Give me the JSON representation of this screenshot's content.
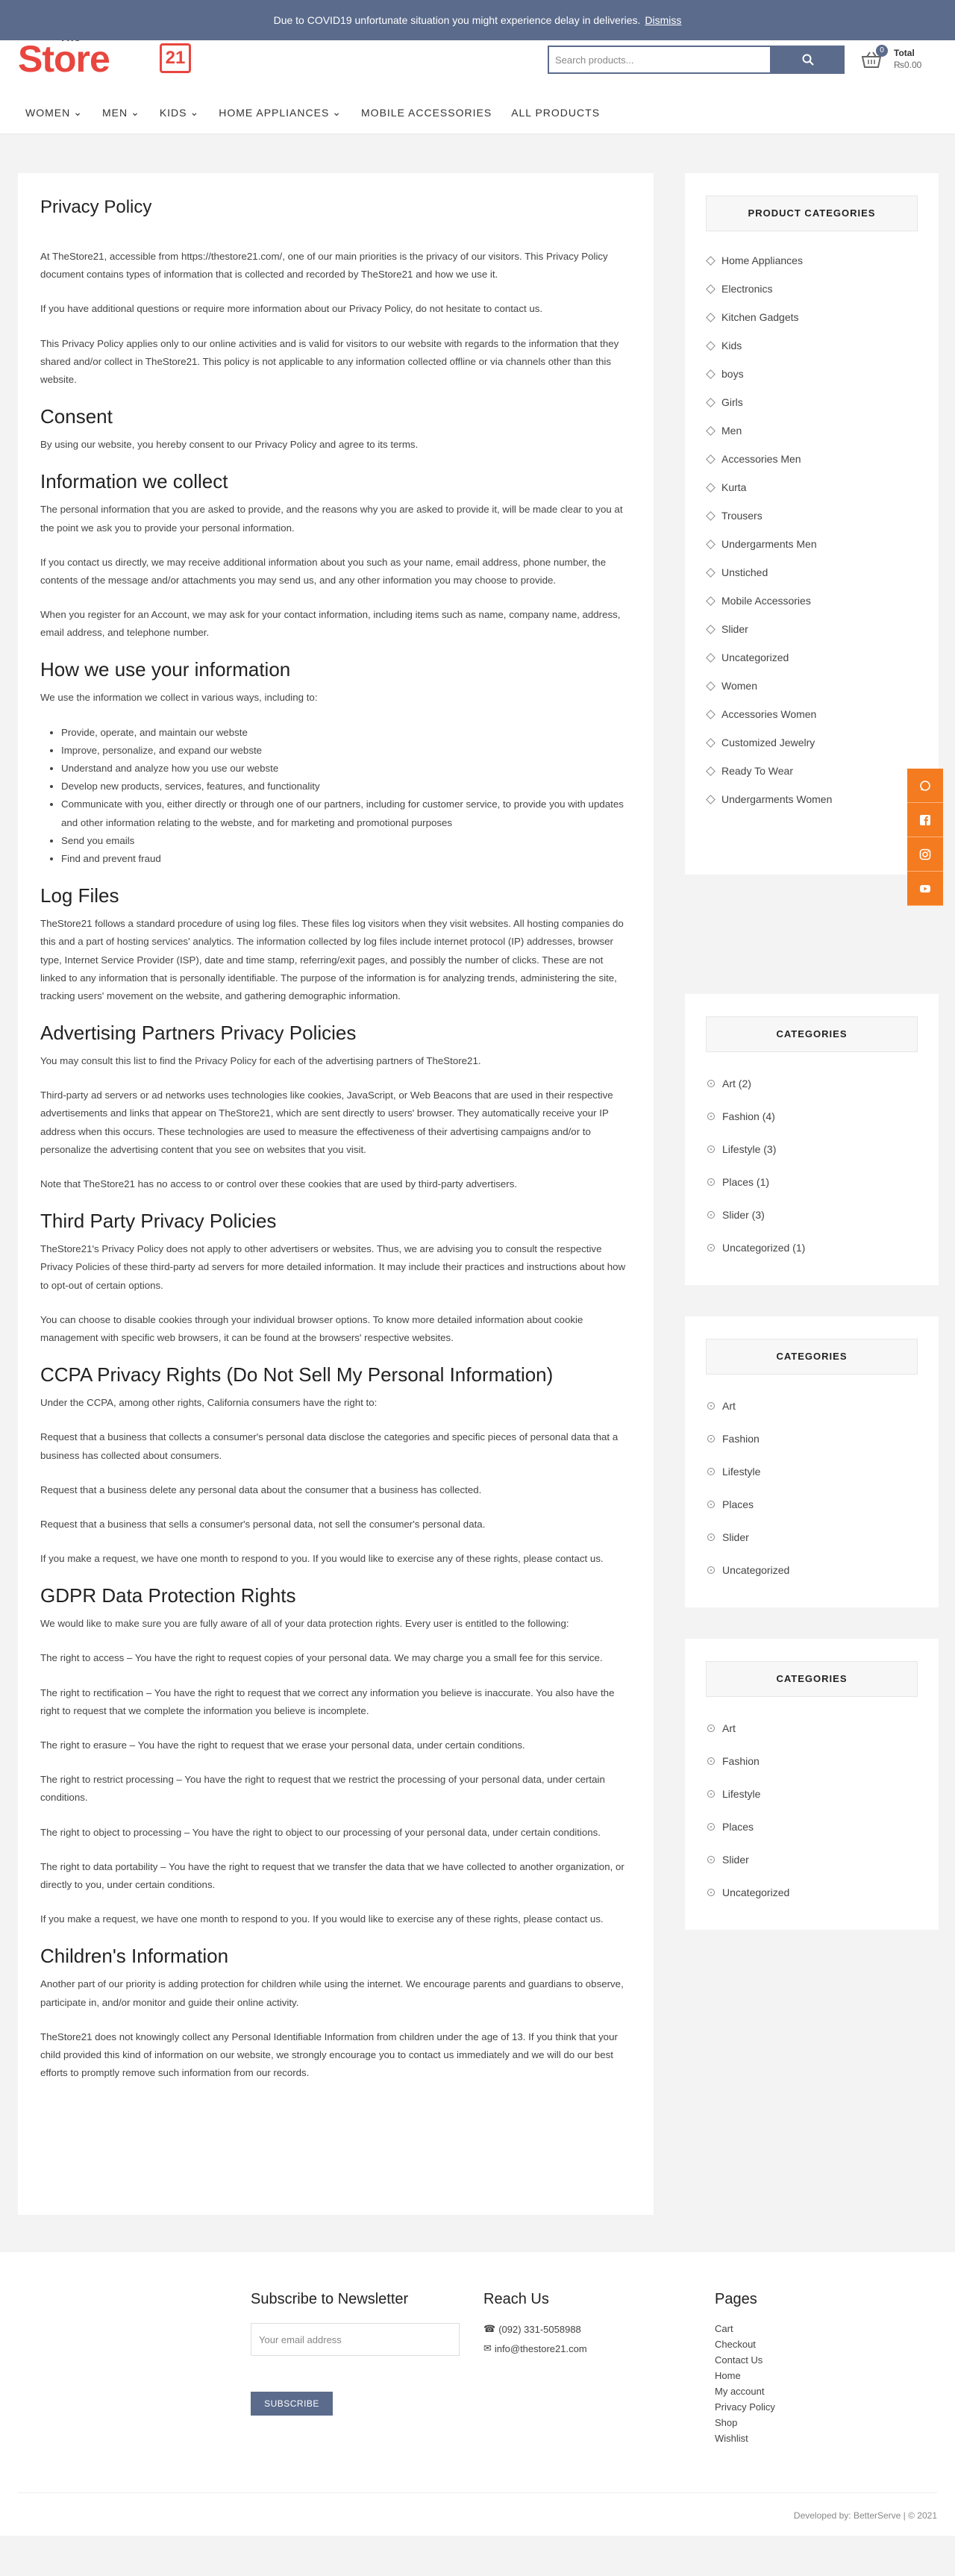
{
  "notice": {
    "text": "Due to COVID19 unfortunate situation you might experience delay in deliveries.",
    "dismiss": "Dismiss"
  },
  "header": {
    "logo": {
      "the": "The",
      "store": "Store",
      "num": "21"
    },
    "search_placeholder": "Search products...",
    "cart": {
      "count": "0",
      "label": "Total",
      "amount": "₨0.00"
    },
    "nav": [
      "WOMEN",
      "MEN",
      "KIDS",
      "HOME APPLIANCES",
      "MOBILE ACCESSORIES",
      "ALL PRODUCTS"
    ]
  },
  "page": {
    "title": "Privacy Policy",
    "intro": [
      "At TheStore21, accessible from https://thestore21.com/, one of our main priorities is the privacy of our visitors. This Privacy Policy document contains types of information that is collected and recorded by TheStore21 and how we use it.",
      "If you have additional questions or require more information about our Privacy Policy, do not hesitate to contact us.",
      "This Privacy Policy applies only to our online activities and is valid for visitors to our website with regards to the information that they shared and/or collect in TheStore21. This policy is not applicable to any information collected offline or via channels other than this website."
    ],
    "consent_h": "Consent",
    "consent_p": "By using our website, you hereby consent to our Privacy Policy and agree to its terms.",
    "collect_h": "Information we collect",
    "collect_p": [
      "The personal information that you are asked to provide, and the reasons why you are asked to provide it, will be made clear to you at the point we ask you to provide your personal information.",
      "If you contact us directly, we may receive additional information about you such as your name, email address, phone number, the contents of the message and/or attachments you may send us, and any other information you may choose to provide.",
      "When you register for an Account, we may ask for your contact information, including items such as name, company name, address, email address, and telephone number."
    ],
    "use_h": "How we use your information",
    "use_p": "We use the information we collect in various ways, including to:",
    "use_list": [
      "Provide, operate, and maintain our webste",
      "Improve, personalize, and expand our webste",
      "Understand and analyze how you use our webste",
      "Develop new products, services, features, and functionality",
      "Communicate with you, either directly or through one of our partners, including for customer service, to provide you with updates and other information relating to the webste, and for marketing and promotional purposes",
      "Send you emails",
      "Find and prevent fraud"
    ],
    "log_h": "Log Files",
    "log_p": "TheStore21 follows a standard procedure of using log files. These files log visitors when they visit websites. All hosting companies do this and a part of hosting services' analytics. The information collected by log files include internet protocol (IP) addresses, browser type, Internet Service Provider (ISP), date and time stamp, referring/exit pages, and possibly the number of clicks. These are not linked to any information that is personally identifiable. The purpose of the information is for analyzing trends, administering the site, tracking users' movement on the website, and gathering demographic information.",
    "adv_h": "Advertising Partners Privacy Policies",
    "adv_p": [
      "You may consult this list to find the Privacy Policy for each of the advertising partners of TheStore21.",
      "Third-party ad servers or ad networks uses technologies like cookies, JavaScript, or Web Beacons that are used in their respective advertisements and links that appear on TheStore21, which are sent directly to users' browser. They automatically receive your IP address when this occurs. These technologies are used to measure the effectiveness of their advertising campaigns and/or to personalize the advertising content that you see on websites that you visit.",
      "Note that TheStore21 has no access to or control over these cookies that are used by third-party advertisers."
    ],
    "third_h": "Third Party Privacy Policies",
    "third_p": [
      "TheStore21's Privacy Policy does not apply to other advertisers or websites. Thus, we are advising you to consult the respective Privacy Policies of these third-party ad servers for more detailed information. It may include their practices and instructions about how to opt-out of certain options.",
      "You can choose to disable cookies through your individual browser options. To know more detailed information about cookie management with specific web browsers, it can be found at the browsers' respective websites."
    ],
    "ccpa_h": "CCPA Privacy Rights (Do Not Sell My Personal Information)",
    "ccpa_p": [
      "Under the CCPA, among other rights, California consumers have the right to:",
      "Request that a business that collects a consumer's personal data disclose the categories and specific pieces of personal data that a business has collected about consumers.",
      "Request that a business delete any personal data about the consumer that a business has collected.",
      "Request that a business that sells a consumer's personal data, not sell the consumer's personal data.",
      "If you make a request, we have one month to respond to you. If you would like to exercise any of these rights, please contact us."
    ],
    "gdpr_h": "GDPR Data Protection Rights",
    "gdpr_p": [
      "We would like to make sure you are fully aware of all of your data protection rights. Every user is entitled to the following:",
      "The right to access – You have the right to request copies of your personal data. We may charge you a small fee for this service.",
      "The right to rectification – You have the right to request that we correct any information you believe is inaccurate. You also have the right to request that we complete the information you believe is incomplete.",
      "The right to erasure – You have the right to request that we erase your personal data, under certain conditions.",
      "The right to restrict processing – You have the right to request that we restrict the processing of your personal data, under certain conditions.",
      "The right to object to processing – You have the right to object to our processing of your personal data, under certain conditions.",
      "The right to data portability – You have the right to request that we transfer the data that we have collected to another organization, or directly to you, under certain conditions.",
      "If you make a request, we have one month to respond to you. If you would like to exercise any of these rights, please contact us."
    ],
    "children_h": "Children's Information",
    "children_p": [
      "Another part of our priority is adding protection for children while using the internet. We encourage parents and guardians to observe, participate in, and/or monitor and guide their online activity.",
      "TheStore21 does not knowingly collect any Personal Identifiable Information from children under the age of 13. If you think that your child provided this kind of information on our website, we strongly encourage you to contact us immediately and we will do our best efforts to promptly remove such information from our records."
    ]
  },
  "sidebar": {
    "product_categories": {
      "title": "PRODUCT CATEGORIES",
      "items": [
        "Home Appliances",
        "Electronics",
        "Kitchen Gadgets",
        "Kids",
        "boys",
        "Girls",
        "Men",
        "Accessories Men",
        "Kurta",
        "Trousers",
        "Undergarments Men",
        "Unstiched",
        "Mobile Accessories",
        "Slider",
        "Uncategorized",
        "Women",
        "Accessories Women",
        "Customized Jewelry",
        "Ready To Wear",
        "Undergarments Women"
      ]
    },
    "categories_counts": {
      "title": "CATEGORIES",
      "items": [
        "Art (2)",
        "Fashion (4)",
        "Lifestyle (3)",
        "Places (1)",
        "Slider (3)",
        "Uncategorized (1)"
      ]
    },
    "categories_2": {
      "title": "CATEGORIES",
      "items": [
        "Art",
        "Fashion",
        "Lifestyle",
        "Places",
        "Slider",
        "Uncategorized"
      ]
    },
    "categories_3": {
      "title": "CATEGORIES",
      "items": [
        "Art",
        "Fashion",
        "Lifestyle",
        "Places",
        "Slider",
        "Uncategorized"
      ]
    }
  },
  "footer": {
    "newsletter": {
      "title": "Subscribe to Newsletter",
      "placeholder": "Your email address",
      "button": "SUBSCRIBE"
    },
    "reach": {
      "title": "Reach Us",
      "phone": "(092) 331-5058988",
      "email": "info@thestore21.com"
    },
    "pages": {
      "title": "Pages",
      "items": [
        "Cart",
        "Checkout",
        "Contact Us",
        "Home",
        "My account",
        "Privacy Policy",
        "Shop",
        "Wishlist"
      ]
    },
    "copyright": "Developed by: BetterServe | © 2021"
  },
  "colors": {
    "accent": "#5b6b8c",
    "brand": "#e8463f",
    "social": "#f47b20"
  }
}
